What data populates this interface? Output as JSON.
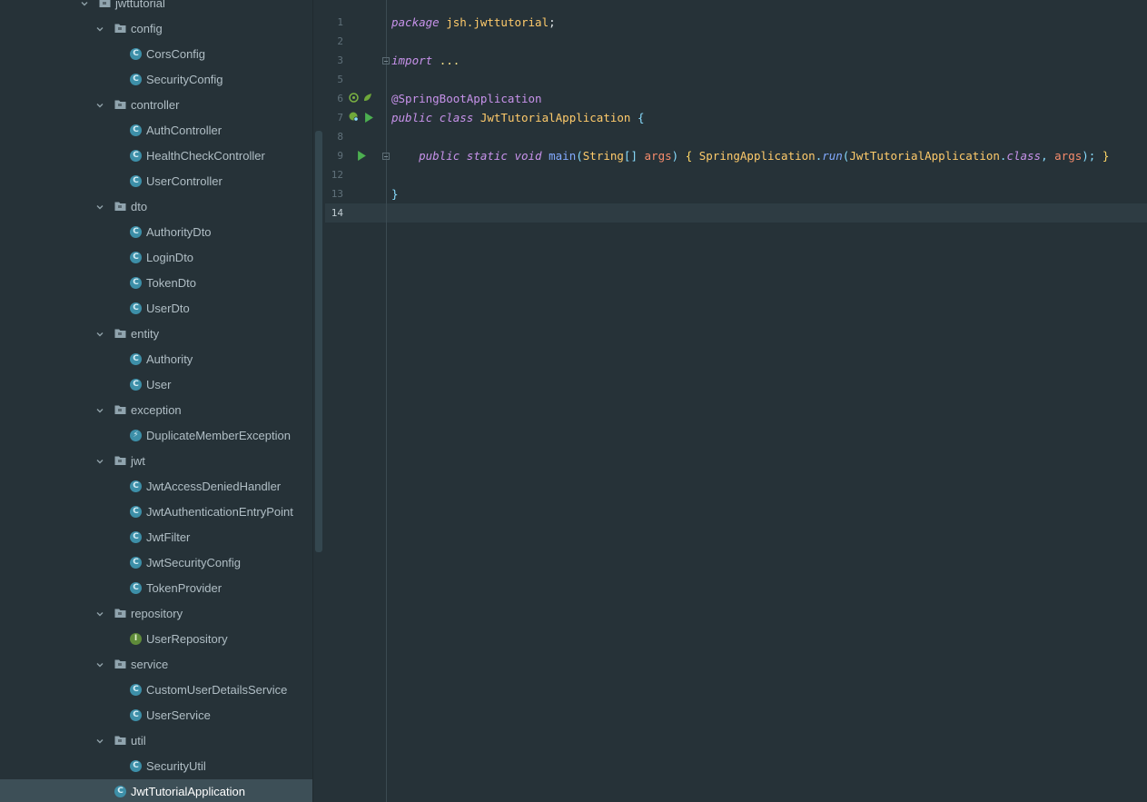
{
  "project_tree": {
    "root": "jwttutorial",
    "packages": [
      {
        "name": "config",
        "items": [
          {
            "name": "CorsConfig",
            "kind": "class"
          },
          {
            "name": "SecurityConfig",
            "kind": "class"
          }
        ]
      },
      {
        "name": "controller",
        "items": [
          {
            "name": "AuthController",
            "kind": "class"
          },
          {
            "name": "HealthCheckController",
            "kind": "class"
          },
          {
            "name": "UserController",
            "kind": "class"
          }
        ]
      },
      {
        "name": "dto",
        "items": [
          {
            "name": "AuthorityDto",
            "kind": "class"
          },
          {
            "name": "LoginDto",
            "kind": "class"
          },
          {
            "name": "TokenDto",
            "kind": "class"
          },
          {
            "name": "UserDto",
            "kind": "class"
          }
        ]
      },
      {
        "name": "entity",
        "items": [
          {
            "name": "Authority",
            "kind": "class"
          },
          {
            "name": "User",
            "kind": "class"
          }
        ]
      },
      {
        "name": "exception",
        "items": [
          {
            "name": "DuplicateMemberException",
            "kind": "exception"
          }
        ]
      },
      {
        "name": "jwt",
        "items": [
          {
            "name": "JwtAccessDeniedHandler",
            "kind": "class"
          },
          {
            "name": "JwtAuthenticationEntryPoint",
            "kind": "class"
          },
          {
            "name": "JwtFilter",
            "kind": "class"
          },
          {
            "name": "JwtSecurityConfig",
            "kind": "class"
          },
          {
            "name": "TokenProvider",
            "kind": "class"
          }
        ]
      },
      {
        "name": "repository",
        "items": [
          {
            "name": "UserRepository",
            "kind": "interface"
          }
        ]
      },
      {
        "name": "service",
        "items": [
          {
            "name": "CustomUserDetailsService",
            "kind": "class"
          },
          {
            "name": "UserService",
            "kind": "class"
          }
        ]
      },
      {
        "name": "util",
        "items": [
          {
            "name": "SecurityUtil",
            "kind": "class"
          }
        ]
      }
    ],
    "selected_file": "JwtTutorialApplication"
  },
  "editor": {
    "line_numbers": [
      "1",
      "2",
      "3",
      "5",
      "6",
      "7",
      "8",
      "9",
      "12",
      "13",
      "14"
    ],
    "active_line": "14",
    "code": {
      "l1_package_kw": "package",
      "l1_package_name": "jsh.jwttutorial",
      "l1_semicolon": ";",
      "l3_import_kw": "import",
      "l3_dots": "...",
      "l6_annotation": "@SpringBootApplication",
      "l7_public": "public",
      "l7_class": "class",
      "l7_name": "JwtTutorialApplication",
      "l7_brace": "{",
      "l9_public": "public",
      "l9_static": "static",
      "l9_void": "void",
      "l9_main": "main",
      "l9_paren_open": "(",
      "l9_string": "String",
      "l9_array": "[]",
      "l9_args": "args",
      "l9_paren_close": ")",
      "l9_lbrace": "{",
      "l9_springapp": "SpringApplication",
      "l9_dot": ".",
      "l9_run": "run",
      "l9_paren2": "(",
      "l9_appclass": "JwtTutorialApplication",
      "l9_dot2": ".",
      "l9_classkw": "class",
      "l9_comma": ",",
      "l9_args2": "args",
      "l9_close": ");",
      "l9_rbrace": "}",
      "l13_brace": "}"
    }
  },
  "colors": {
    "background": "#263238",
    "keyword": "#c792ea",
    "type": "#ffcb6b",
    "function": "#82aaff",
    "param": "#f78c6c",
    "class_icon": "#3d8fa8",
    "interface_icon": "#5f8b3a"
  },
  "icons": {
    "package": "folder-icon",
    "class": "class-icon",
    "interface": "interface-icon",
    "run_gutter": "run-icon",
    "spring_bean_gutter": "spring-bean-icon",
    "fold": "fold-icon"
  }
}
